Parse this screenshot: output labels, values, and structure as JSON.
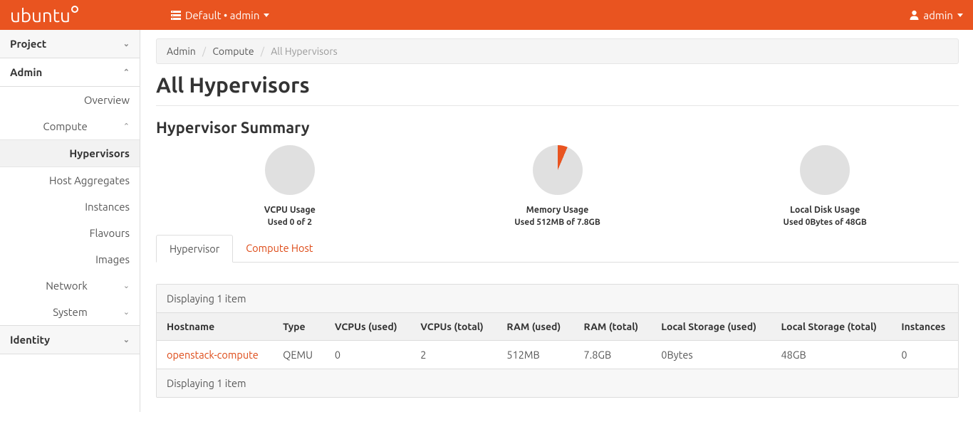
{
  "header": {
    "logo_text": "ubuntu",
    "project_selector": "Default • admin",
    "user_label": "admin"
  },
  "sidebar": {
    "project_label": "Project",
    "admin_label": "Admin",
    "overview_label": "Overview",
    "compute_label": "Compute",
    "hypervisors_label": "Hypervisors",
    "host_aggregates_label": "Host Aggregates",
    "instances_label": "Instances",
    "flavours_label": "Flavours",
    "images_label": "Images",
    "network_label": "Network",
    "system_label": "System",
    "identity_label": "Identity"
  },
  "breadcrumb": {
    "item0": "Admin",
    "item1": "Compute",
    "item2": "All Hypervisors"
  },
  "page": {
    "title": "All Hypervisors",
    "summary_title": "Hypervisor Summary"
  },
  "chart_data": [
    {
      "type": "pie",
      "title": "VCPU Usage",
      "subtitle": "Used 0 of 2",
      "used": 0,
      "total": 2,
      "fraction": 0
    },
    {
      "type": "pie",
      "title": "Memory Usage",
      "subtitle": "Used 512MB of 7.8GB",
      "used_label": "512MB",
      "total_label": "7.8GB",
      "fraction": 0.064
    },
    {
      "type": "pie",
      "title": "Local Disk Usage",
      "subtitle": "Used 0Bytes of 48GB",
      "used_label": "0Bytes",
      "total_label": "48GB",
      "fraction": 0
    }
  ],
  "tabs": {
    "hypervisor": "Hypervisor",
    "compute_host": "Compute Host"
  },
  "table": {
    "caption": "Displaying 1 item",
    "footer": "Displaying 1 item",
    "columns": {
      "hostname": "Hostname",
      "type": "Type",
      "vcpus_used": "VCPUs (used)",
      "vcpus_total": "VCPUs (total)",
      "ram_used": "RAM (used)",
      "ram_total": "RAM (total)",
      "ls_used": "Local Storage (used)",
      "ls_total": "Local Storage (total)",
      "instances": "Instances"
    },
    "rows": [
      {
        "hostname": "openstack-compute",
        "type": "QEMU",
        "vcpus_used": "0",
        "vcpus_total": "2",
        "ram_used": "512MB",
        "ram_total": "7.8GB",
        "ls_used": "0Bytes",
        "ls_total": "48GB",
        "instances": "0"
      }
    ]
  }
}
